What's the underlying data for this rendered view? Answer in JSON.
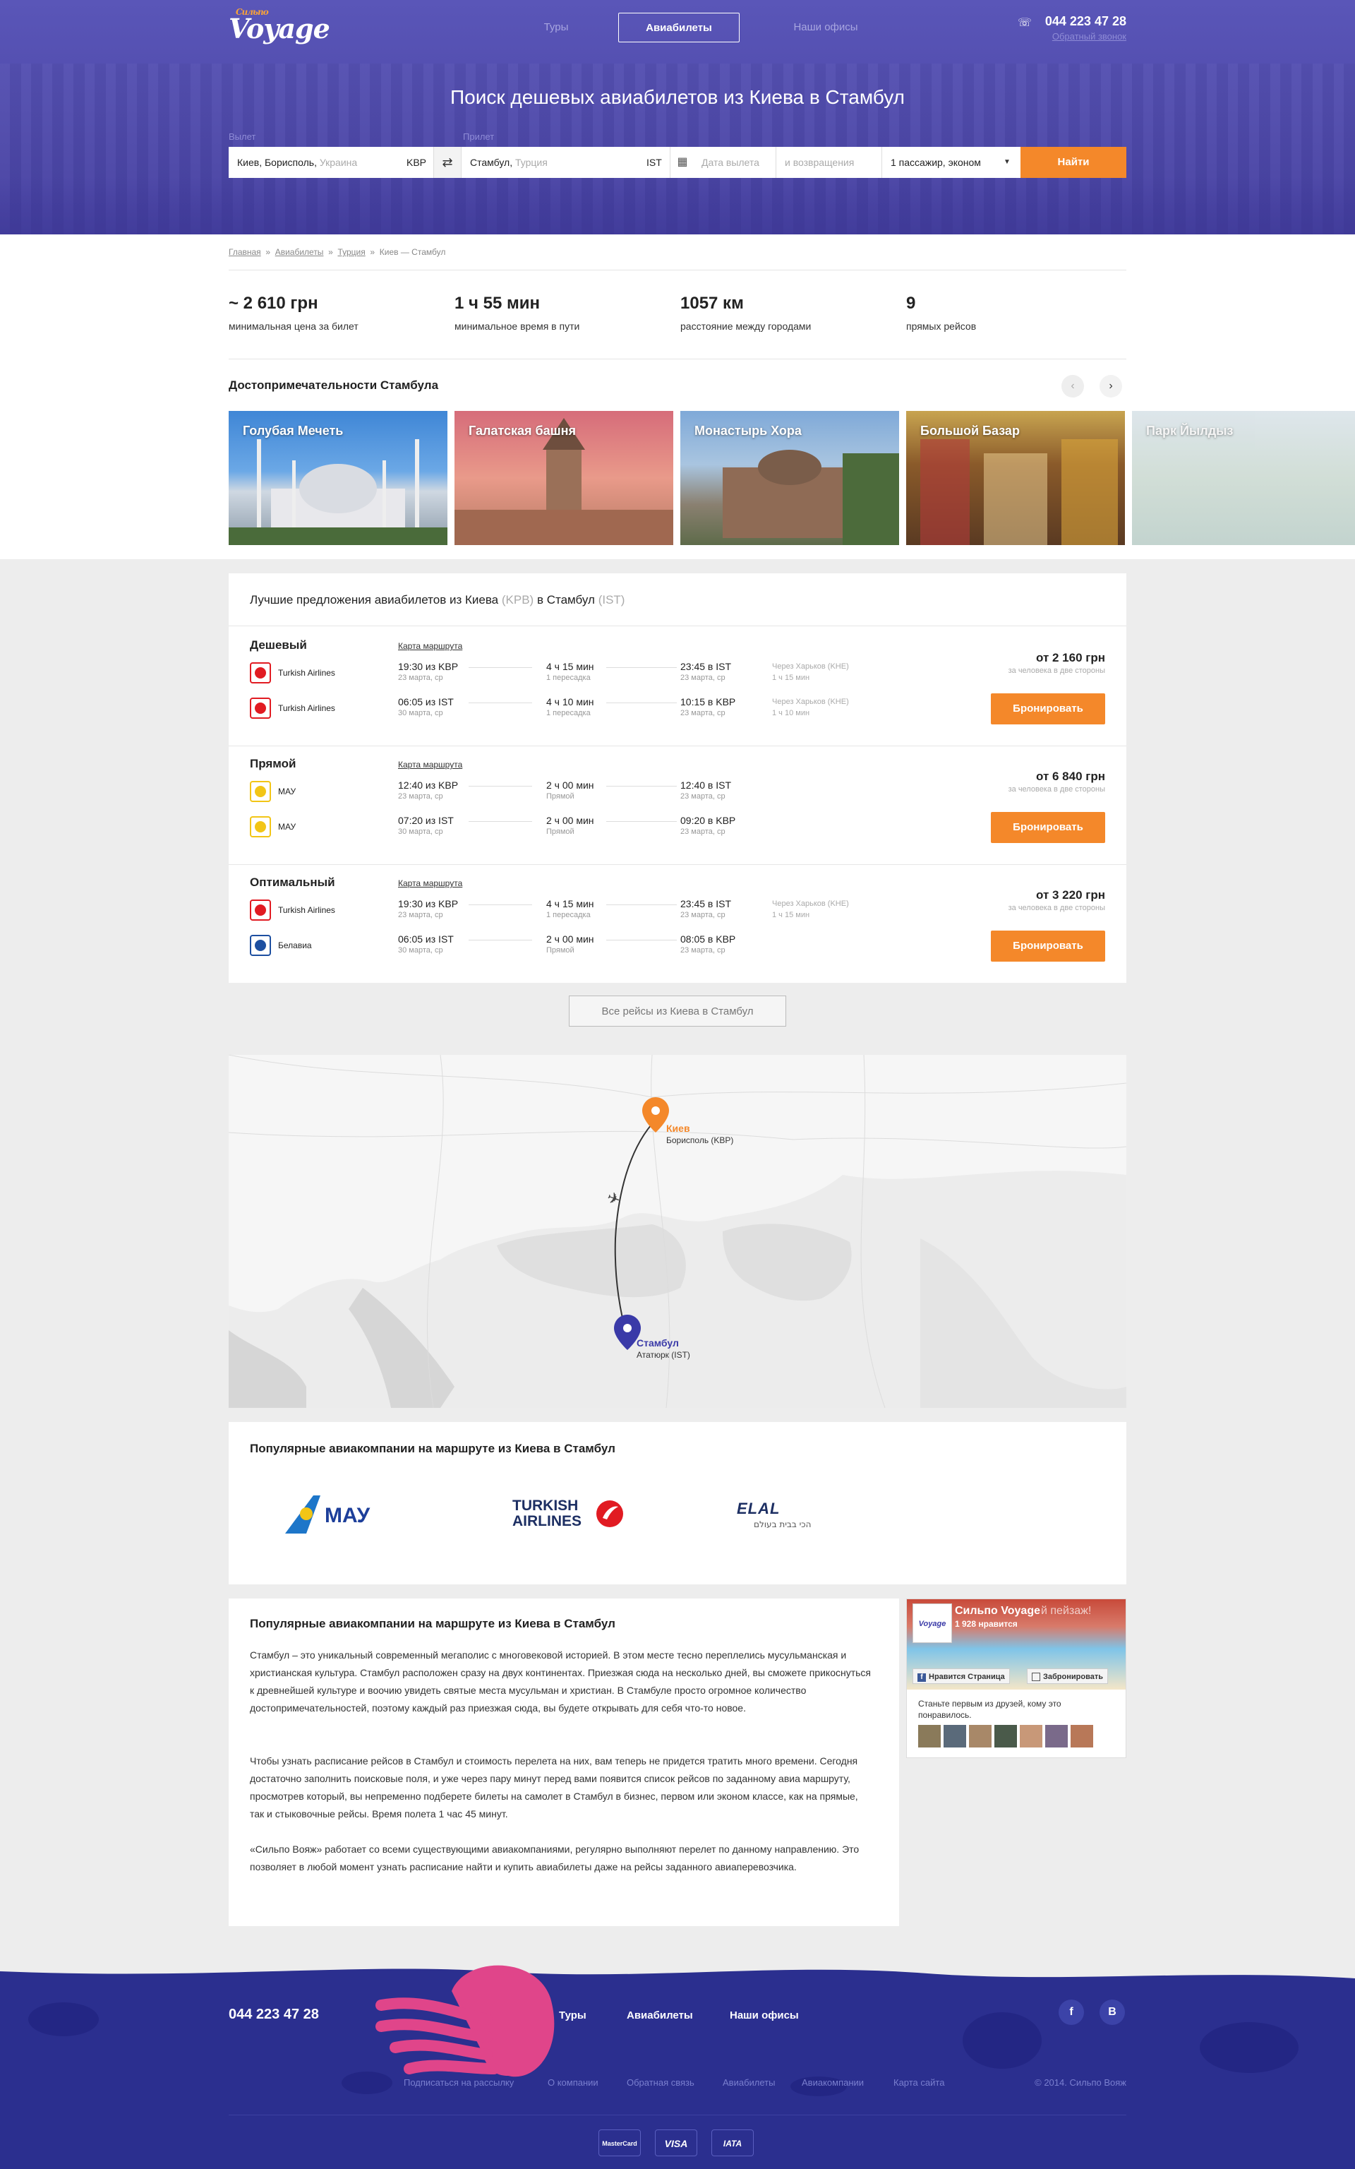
{
  "header": {
    "logo_text": "Voyage",
    "logo_small": "Сильпо",
    "nav": [
      "Туры",
      "Авиабилеты",
      "Наши офисы"
    ],
    "phone": "044 223 47 28",
    "callback": "Обратный звонок"
  },
  "search": {
    "title": "Поиск дешевых авиабилетов из Киева в Стамбул",
    "from_label": "Вылет",
    "to_label": "Прилет",
    "from_value": "Киев, Борисполь,",
    "from_hint": "Украина",
    "from_code": "KBP",
    "to_value": "Стамбул,",
    "to_hint": "Турция",
    "to_code": "IST",
    "depart_placeholder": "Дата вылета",
    "return_placeholder": "и возвращения",
    "passengers": "1 пассажир, эконом",
    "find_button": "Найти"
  },
  "breadcrumbs": [
    "Главная",
    "Авиабилеты",
    "Турция",
    "Киев — Стамбул"
  ],
  "stats": [
    {
      "value": "~ 2 610 грн",
      "label": "минимальная цена за билет"
    },
    {
      "value": "1 ч 55 мин",
      "label": "минимальное время в пути"
    },
    {
      "value": "1057 км",
      "label": "расстояние между городами"
    },
    {
      "value": "9",
      "label": "прямых рейсов"
    }
  ],
  "sights": {
    "title": "Достопримечательности Стамбула",
    "items": [
      "Голубая Мечеть",
      "Галатская башня",
      "Монастырь Хора",
      "Большой Базар",
      "Парк Йылдыз"
    ]
  },
  "offers": {
    "title_start": "Лучшие предложения авиабилетов из Киева",
    "from_code": "(KPB)",
    "title_mid": "в Стамбул",
    "to_code": "(IST)",
    "map_link": "Карта маршрута",
    "book": "Бронировать",
    "groups": [
      {
        "name": "Дешевый",
        "price": "от 2 160 грн",
        "price_note": "за человека в две стороны",
        "legs": [
          {
            "airline": "Turkish Airlines",
            "dep": "19:30 из KBP",
            "dep_date": "23 марта, ср",
            "dur": "4 ч 15 мин",
            "stops": "1 пересадка",
            "arr": "23:45 в IST",
            "arr_date": "23 марта, ср",
            "via": "Через Харьков (KHE)",
            "via_time": "1 ч 15 мин"
          },
          {
            "airline": "Turkish Airlines",
            "dep": "06:05 из IST",
            "dep_date": "30 марта, ср",
            "dur": "4 ч 10 мин",
            "stops": "1 пересадка",
            "arr": "10:15 в KBP",
            "arr_date": "23 марта, ср",
            "via": "Через Харьков (KHE)",
            "via_time": "1 ч 10 мин"
          }
        ]
      },
      {
        "name": "Прямой",
        "price": "от 6 840 грн",
        "price_note": "за человека в две стороны",
        "legs": [
          {
            "airline": "МАУ",
            "dep": "12:40 из KBP",
            "dep_date": "23 марта, ср",
            "dur": "2 ч 00 мин",
            "stops": "Прямой",
            "arr": "12:40 в IST",
            "arr_date": "23 марта, ср",
            "via": "",
            "via_time": ""
          },
          {
            "airline": "МАУ",
            "dep": "07:20 из IST",
            "dep_date": "30 марта, ср",
            "dur": "2 ч 00 мин",
            "stops": "Прямой",
            "arr": "09:20 в KBP",
            "arr_date": "23 марта, ср",
            "via": "",
            "via_time": ""
          }
        ]
      },
      {
        "name": "Оптимальный",
        "price": "от 3 220 грн",
        "price_note": "за человека в две стороны",
        "legs": [
          {
            "airline": "Turkish Airlines",
            "dep": "19:30 из KBP",
            "dep_date": "23 марта, ср",
            "dur": "4 ч 15 мин",
            "stops": "1 пересадка",
            "arr": "23:45 в IST",
            "arr_date": "23 марта, ср",
            "via": "Через Харьков (KHE)",
            "via_time": "1 ч 15 мин"
          },
          {
            "airline": "Белавиа",
            "dep": "06:05 из IST",
            "dep_date": "30 марта, ср",
            "dur": "2 ч 00 мин",
            "stops": "Прямой",
            "arr": "08:05 в KBP",
            "arr_date": "23 марта, ср",
            "via": "",
            "via_time": ""
          }
        ]
      }
    ],
    "all_flights": "Все рейсы из Киева в Стамбул"
  },
  "map": {
    "from_city": "Киев",
    "from_airport": "Борисполь (KBP)",
    "to_city": "Стамбул",
    "to_airport": "Ататюрк (IST)"
  },
  "airlines": {
    "title": "Популярные авиакомпании на маршруте из Киева в Стамбул",
    "logos": [
      "МАУ",
      "TURKISH",
      "AIRLINES",
      "ELAL",
      "הכי בבית בעולם"
    ]
  },
  "about": {
    "title": "Популярные авиакомпании на маршруте из Киева в Стамбул",
    "p1": "Стамбул – это уникальный современный мегаполис с многовековой историей. В этом месте тесно переплелись мусульманская и христианская культура. Стамбул расположен сразу на двух континентах. Приезжая сюда на несколько дней, вы сможете прикоснуться к древнейшей культуре и воочию увидеть святые места мусульман и христиан. В Стамбуле просто огромное количество достопримечательностей, поэтому каждый раз приезжая сюда, вы будете открывать для себя что-то новое.",
    "p2": "Чтобы узнать расписание рейсов в Стамбул и стоимость перелета на них, вам теперь не придется тратить много времени. Сегодня  достаточно заполнить поисковые поля, и уже через пару минут перед вами появится список рейсов по заданному авиа маршруту, просмотрев который, вы непременно подберете билеты на самолет в Стамбул в бизнес, первом или эконом классе, как на прямые, так и стыковочные рейсы. Время полета 1 час 45 минут.",
    "p3": "«Сильпо Вояж» работает со всеми существующими авиакомпаниями, регулярно выполняют перелет по данному направлению. Это позволяет в любой момент узнать расписание найти и купить авиабилеты даже на рейсы заданного авиаперевозчика."
  },
  "fb": {
    "name": "Сильпо Voyage",
    "likes": "1 928 нравится",
    "overlay": "й пейзаж!",
    "like_btn": "Нравится Страница",
    "book_btn": "Забронировать",
    "note": "Станьте первым из друзей, кому это понравилось."
  },
  "footer": {
    "phone": "044 223 47 28",
    "nav": [
      "Туры",
      "Авиабилеты",
      "Наши офисы"
    ],
    "social": [
      "f",
      "B"
    ],
    "links": [
      "Подписаться на рассылку",
      "О компании",
      "Обратная связь",
      "Авиабилеты",
      "Авиакомпании",
      "Карта сайта"
    ],
    "copyright": "© 2014. Сильпо Вояж",
    "payments": [
      "MasterCard",
      "VISA",
      "IATA"
    ]
  },
  "colors": {
    "accent": "#f4882a",
    "hero": "#4f4aab",
    "footer": "#2b2f8f"
  }
}
